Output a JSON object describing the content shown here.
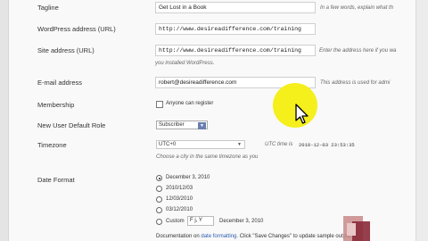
{
  "tagline": {
    "label": "Tagline",
    "value": "Get Lost in a Book",
    "description": "In a few words, explain what th"
  },
  "wp_address": {
    "label": "WordPress address (URL)",
    "value": "http://www.desireadifference.com/training"
  },
  "site_address": {
    "label": "Site address (URL)",
    "value": "http://www.desireadifference.com/training",
    "description_line1": "Enter the address here if you wa",
    "description_line2": "you installed WordPress."
  },
  "email": {
    "label": "E-mail address",
    "value": "robert@desireadifference.com",
    "description": "This address is used for admi"
  },
  "membership": {
    "label": "Membership",
    "checkbox_label": "Anyone can register"
  },
  "default_role": {
    "label": "New User Default Role",
    "selected": "Subscriber"
  },
  "timezone": {
    "label": "Timezone",
    "selected": "UTC+0",
    "utc_label": "UTC time is",
    "utc_value": "2010-12-03 23:53:35",
    "description": "Choose a city in the same timezone as you"
  },
  "date_format": {
    "label": "Date Format",
    "options": [
      {
        "label": "December 3, 2010",
        "checked": true
      },
      {
        "label": "2010/12/03",
        "checked": false
      },
      {
        "label": "12/03/2010",
        "checked": false
      },
      {
        "label": "03/12/2010",
        "checked": false
      }
    ],
    "custom_label": "Custom",
    "custom_value": "F j, Y",
    "custom_preview": "December 3, 2010"
  },
  "footer": {
    "doc_text": "Documentation on",
    "doc_link": "date formatting",
    "doc_rest": ". Click \"Save Changes\" to update sample output."
  },
  "colors": {
    "highlight": "#f4ee10",
    "link": "#2a5db0"
  }
}
